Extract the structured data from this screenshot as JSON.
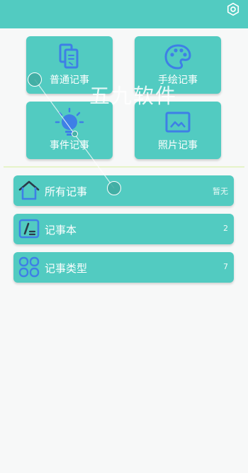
{
  "colors": {
    "accent": "#52cbc1",
    "icon_blue": "#3e7fe6",
    "background": "#f7f8f8"
  },
  "header": {
    "settings_icon": "gear-icon"
  },
  "quick_actions": [
    {
      "label": "普通记事",
      "icon": "documents-icon"
    },
    {
      "label": "手绘记事",
      "icon": "palette-icon"
    },
    {
      "label": "事件记事",
      "icon": "lightbulb-icon"
    },
    {
      "label": "照片记事",
      "icon": "image-icon"
    }
  ],
  "categories": [
    {
      "label": "所有记事",
      "count": "暂无",
      "icon": "home-icon"
    },
    {
      "label": "记事本",
      "count": "2",
      "icon": "notebook-icon"
    },
    {
      "label": "记事类型",
      "count": "7",
      "icon": "grid-icon"
    }
  ],
  "watermark": "五九软件"
}
